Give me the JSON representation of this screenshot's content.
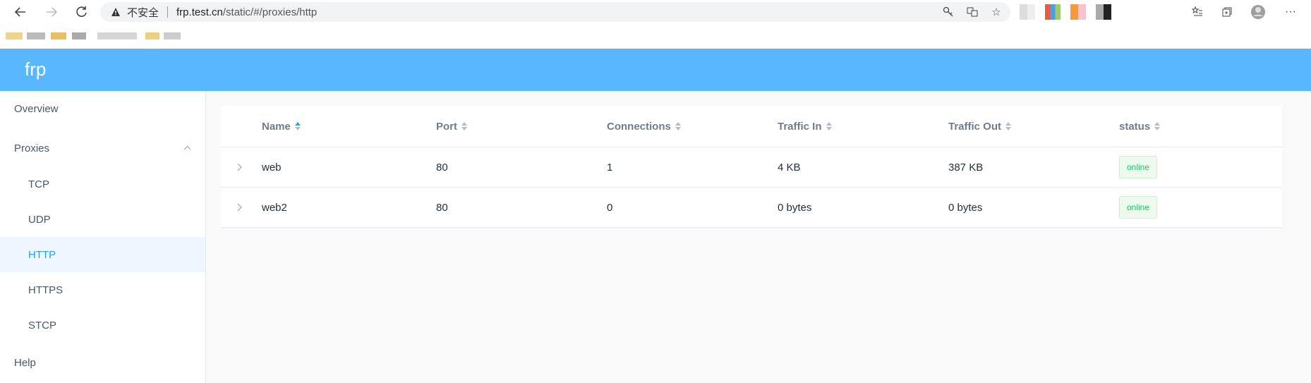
{
  "browser": {
    "warning_text": "不安全",
    "url_host": "frp.test.cn",
    "url_path": "/static/#/proxies/http"
  },
  "app": {
    "brand": "frp"
  },
  "sidebar": {
    "items": [
      {
        "label": "Overview"
      },
      {
        "label": "Proxies"
      },
      {
        "label": "TCP"
      },
      {
        "label": "UDP"
      },
      {
        "label": "HTTP"
      },
      {
        "label": "HTTPS"
      },
      {
        "label": "STCP"
      },
      {
        "label": "Help"
      }
    ],
    "active": "HTTP"
  },
  "table": {
    "headers": [
      "Name",
      "Port",
      "Connections",
      "Traffic In",
      "Traffic Out",
      "status"
    ],
    "sorted_column": "Name",
    "rows": [
      {
        "name": "web",
        "port": "80",
        "connections": "1",
        "traffic_in": "4 KB",
        "traffic_out": "387 KB",
        "status": "online"
      },
      {
        "name": "web2",
        "port": "80",
        "connections": "0",
        "traffic_in": "0 bytes",
        "traffic_out": "0 bytes",
        "status": "online"
      }
    ]
  },
  "colors": {
    "header_bg": "#58b7ff",
    "active_text": "#20a0ff",
    "status_online": "#13ce66"
  }
}
